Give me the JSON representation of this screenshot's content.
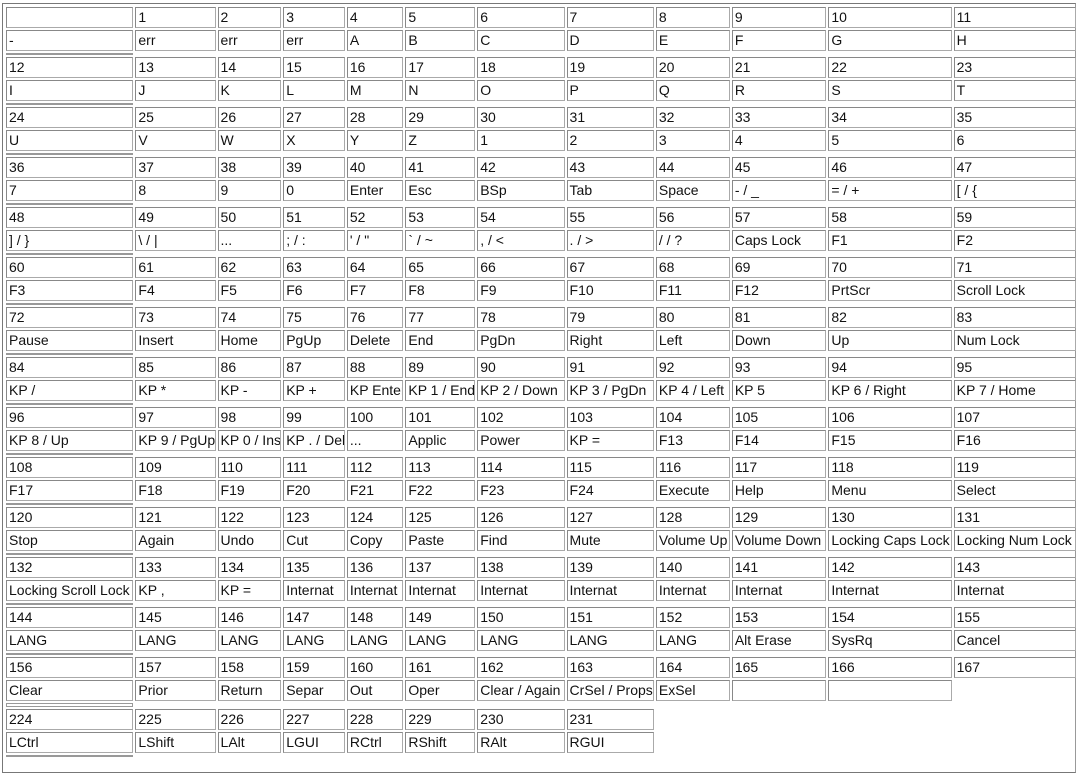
{
  "groups": [
    {
      "numbers": [
        "",
        "1",
        "2",
        "3",
        "4",
        "5",
        "6",
        "7",
        "8",
        "9",
        "10",
        "11"
      ],
      "labels": [
        "-",
        "err",
        "err",
        "err",
        "A",
        "B",
        "C",
        "D",
        "E",
        "F",
        "G",
        "H"
      ]
    },
    {
      "numbers": [
        "12",
        "13",
        "14",
        "15",
        "16",
        "17",
        "18",
        "19",
        "20",
        "21",
        "22",
        "23"
      ],
      "labels": [
        "I",
        "J",
        "K",
        "L",
        "M",
        "N",
        "O",
        "P",
        "Q",
        "R",
        "S",
        "T"
      ]
    },
    {
      "numbers": [
        "24",
        "25",
        "26",
        "27",
        "28",
        "29",
        "30",
        "31",
        "32",
        "33",
        "34",
        "35"
      ],
      "labels": [
        "U",
        "V",
        "W",
        "X",
        "Y",
        "Z",
        "1",
        "2",
        "3",
        "4",
        "5",
        "6"
      ]
    },
    {
      "numbers": [
        "36",
        "37",
        "38",
        "39",
        "40",
        "41",
        "42",
        "43",
        "44",
        "45",
        "46",
        "47"
      ],
      "labels": [
        "7",
        "8",
        "9",
        "0",
        "Enter",
        "Esc",
        "BSp",
        "Tab",
        "Space",
        "- / _",
        "= / +",
        "[ / {"
      ]
    },
    {
      "numbers": [
        "48",
        "49",
        "50",
        "51",
        "52",
        "53",
        "54",
        "55",
        "56",
        "57",
        "58",
        "59"
      ],
      "labels": [
        "] / }",
        "\\ / |",
        "...",
        "; / :",
        "' / \"",
        "` / ~",
        ", / <",
        ". / >",
        "/ / ?",
        "Caps Lock",
        "F1",
        "F2"
      ]
    },
    {
      "numbers": [
        "60",
        "61",
        "62",
        "63",
        "64",
        "65",
        "66",
        "67",
        "68",
        "69",
        "70",
        "71"
      ],
      "labels": [
        "F3",
        "F4",
        "F5",
        "F6",
        "F7",
        "F8",
        "F9",
        "F10",
        "F11",
        "F12",
        "PrtScr",
        "Scroll Lock"
      ]
    },
    {
      "numbers": [
        "72",
        "73",
        "74",
        "75",
        "76",
        "77",
        "78",
        "79",
        "80",
        "81",
        "82",
        "83"
      ],
      "labels": [
        "Pause",
        "Insert",
        "Home",
        "PgUp",
        "Delete",
        "End",
        "PgDn",
        "Right",
        "Left",
        "Down",
        "Up",
        "Num Lock"
      ]
    },
    {
      "numbers": [
        "84",
        "85",
        "86",
        "87",
        "88",
        "89",
        "90",
        "91",
        "92",
        "93",
        "94",
        "95"
      ],
      "labels": [
        "KP /",
        "KP *",
        "KP -",
        "KP +",
        "KP Enter",
        "KP 1 / End",
        "KP 2 / Down",
        "KP 3 / PgDn",
        "KP 4 / Left",
        "KP 5",
        "KP 6 / Right",
        "KP 7 / Home"
      ]
    },
    {
      "numbers": [
        "96",
        "97",
        "98",
        "99",
        "100",
        "101",
        "102",
        "103",
        "104",
        "105",
        "106",
        "107"
      ],
      "labels": [
        "KP 8 / Up",
        "KP 9 / PgUp",
        "KP 0 / Ins",
        "KP . / Del",
        "...",
        "Applic",
        "Power",
        "KP =",
        "F13",
        "F14",
        "F15",
        "F16"
      ]
    },
    {
      "numbers": [
        "108",
        "109",
        "110",
        "111",
        "112",
        "113",
        "114",
        "115",
        "116",
        "117",
        "118",
        "119"
      ],
      "labels": [
        "F17",
        "F18",
        "F19",
        "F20",
        "F21",
        "F22",
        "F23",
        "F24",
        "Execute",
        "Help",
        "Menu",
        "Select"
      ]
    },
    {
      "numbers": [
        "120",
        "121",
        "122",
        "123",
        "124",
        "125",
        "126",
        "127",
        "128",
        "129",
        "130",
        "131"
      ],
      "labels": [
        "Stop",
        "Again",
        "Undo",
        "Cut",
        "Copy",
        "Paste",
        "Find",
        "Mute",
        "Volume Up",
        "Volume Down",
        "Locking Caps Lock",
        "Locking Num Lock"
      ]
    },
    {
      "numbers": [
        "132",
        "133",
        "134",
        "135",
        "136",
        "137",
        "138",
        "139",
        "140",
        "141",
        "142",
        "143"
      ],
      "labels": [
        "Locking Scroll Lock",
        "KP ,",
        "KP =",
        "Internat",
        "Internat",
        "Internat",
        "Internat",
        "Internat",
        "Internat",
        "Internat",
        "Internat",
        "Internat"
      ]
    },
    {
      "numbers": [
        "144",
        "145",
        "146",
        "147",
        "148",
        "149",
        "150",
        "151",
        "152",
        "153",
        "154",
        "155"
      ],
      "labels": [
        "LANG",
        "LANG",
        "LANG",
        "LANG",
        "LANG",
        "LANG",
        "LANG",
        "LANG",
        "LANG",
        "Alt Erase",
        "SysRq",
        "Cancel"
      ]
    },
    {
      "numbers": [
        "156",
        "157",
        "158",
        "159",
        "160",
        "161",
        "162",
        "163",
        "164",
        "165",
        "166",
        "167"
      ],
      "labels": [
        "Clear",
        "Prior",
        "Return",
        "Separ",
        "Out",
        "Oper",
        "Clear / Again",
        "CrSel / Props",
        "ExSel",
        "",
        ""
      ]
    },
    {
      "numbers": [
        "224",
        "225",
        "226",
        "227",
        "228",
        "229",
        "230",
        "231"
      ],
      "labels": [
        "LCtrl",
        "LShift",
        "LAlt",
        "LGUI",
        "RCtrl",
        "RShift",
        "RAlt",
        "RGUI"
      ]
    }
  ]
}
